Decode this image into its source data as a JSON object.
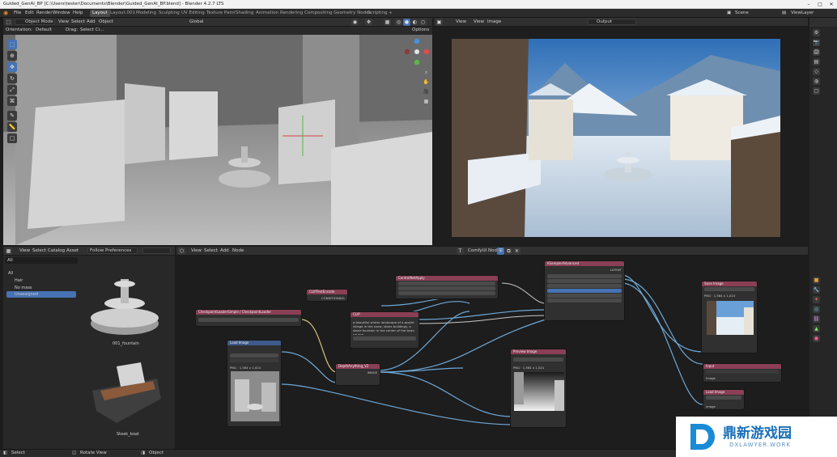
{
  "window": {
    "title": "Guided_GenAI_BP [C:\\Users\\tester\\Documents\\Blender\\Guided_GenAI_BP.blend] - Blender 4.2.7 LTS"
  },
  "menu": [
    "File",
    "Edit",
    "Render",
    "Window",
    "Help"
  ],
  "workspaces": [
    "Layout",
    "Layout.001",
    "Modeling",
    "Sculpting",
    "UV Editing",
    "Texture Paint",
    "Shading",
    "Animation",
    "Rendering",
    "Compositing",
    "Geometry Nodes",
    "Scripting",
    "+"
  ],
  "scene": {
    "scene": "Scene",
    "view_layer": "ViewLayer"
  },
  "viewport": {
    "mode": "Object Mode",
    "menus": [
      "View",
      "Select",
      "Add",
      "Object"
    ],
    "orientation_label": "Orientation:",
    "orientation": "Default",
    "drag_label": "Drag:",
    "drag": "Select Ci...",
    "transform": "Global",
    "options": "Options"
  },
  "image_editor": {
    "menus": [
      "View",
      "View",
      "Image"
    ],
    "image": "Output"
  },
  "asset_browser": {
    "menus": [
      "View",
      "Select",
      "Catalog",
      "Asset"
    ],
    "library": "Follow Preferences",
    "filter": "All",
    "tree": [
      {
        "label": "All"
      },
      {
        "label": "Hair"
      },
      {
        "label": "No mass"
      },
      {
        "label": "Unassigned"
      }
    ],
    "assets": [
      {
        "label": "001_fountain"
      },
      {
        "label": "Steek_boat"
      }
    ]
  },
  "node_editor": {
    "menus": [
      "View",
      "Select",
      "Add",
      "Node"
    ],
    "tree_type": "ComfyUI Node",
    "nodes": [
      {
        "title": "KSamplerAdvanced",
        "out": "LATENT"
      },
      {
        "title": "CLIPTextEncode",
        "out": "CONDITIONING"
      },
      {
        "title": "ControlNetApply",
        "out": "CONDITIONING"
      },
      {
        "title": "CheckpointLoaderSimple / CheckpointLoader",
        "out": "MODEL"
      },
      {
        "title": "CLIP",
        "text": "a beautiful winter landscape of a quaint village in the snow, stone buildings, a stone fountain in the center of the town square"
      },
      {
        "title": "Load Image",
        "size": "PNG · 1,584 x 1,024"
      },
      {
        "title": "DepthAnything_V2",
        "out": "IMAGE"
      },
      {
        "title": "Preview Image",
        "size": "PNG · 1,584 x 1,024"
      },
      {
        "title": "Save Image",
        "size": "PNG · 1,584 x 1,024"
      },
      {
        "title": "Input",
        "label": "Image"
      },
      {
        "title": "Load Image",
        "label": "image"
      }
    ]
  },
  "status": [
    "Select",
    "Rotate View",
    "Object"
  ],
  "watermark": {
    "brand": "鼎新游戏园",
    "sub": "DXLAWYER.WORK"
  },
  "colors": {
    "accent": "#4772b3",
    "node_header": "#8a3f55",
    "link_blue": "#6ea8d6",
    "link_yellow": "#d9c27a"
  }
}
